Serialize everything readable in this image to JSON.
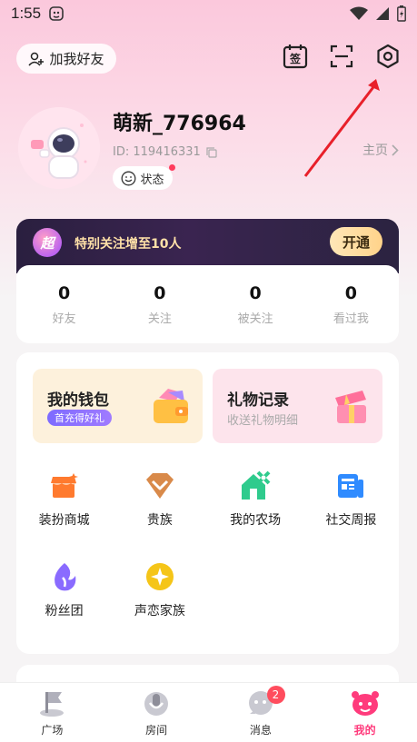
{
  "statusbar": {
    "time": "1:55"
  },
  "header": {
    "add_friend_label": "加我好友",
    "icons": [
      "sign-in-icon",
      "scan-icon",
      "settings-icon"
    ],
    "sign_in_text": "签"
  },
  "profile": {
    "username": "萌新_776964",
    "id_text": "ID: 119416331",
    "status_label": "状态",
    "homepage_label": "主页"
  },
  "vip": {
    "badge_text": "超",
    "text": "特别关注增至10人",
    "button_label": "开通"
  },
  "stats": [
    {
      "value": "0",
      "label": "好友"
    },
    {
      "value": "0",
      "label": "关注"
    },
    {
      "value": "0",
      "label": "被关注"
    },
    {
      "value": "0",
      "label": "看过我"
    }
  ],
  "promos": {
    "wallet": {
      "title": "我的钱包",
      "subtitle": "首充得好礼"
    },
    "gift": {
      "title": "礼物记录",
      "subtitle": "收送礼物明细"
    }
  },
  "features": [
    {
      "label": "装扮商城",
      "icon": "shop-icon",
      "color": "#ff7a2e"
    },
    {
      "label": "贵族",
      "icon": "diamond-icon",
      "color": "#d98a4a"
    },
    {
      "label": "我的农场",
      "icon": "farm-icon",
      "color": "#2fcb8d"
    },
    {
      "label": "社交周报",
      "icon": "report-icon",
      "color": "#2f8bff"
    },
    {
      "label": "粉丝团",
      "icon": "fan-icon",
      "color": "#8a6bff"
    },
    {
      "label": "声恋家族",
      "icon": "family-icon",
      "color": "#f5c518"
    }
  ],
  "tabs": [
    {
      "label": "广场",
      "icon": "plaza-icon"
    },
    {
      "label": "房间",
      "icon": "room-icon"
    },
    {
      "label": "消息",
      "icon": "message-icon",
      "badge": "2"
    },
    {
      "label": "我的",
      "icon": "me-icon",
      "active": true
    }
  ],
  "colors": {
    "accent": "#ff3b7c",
    "arrow": "#e8202a"
  }
}
